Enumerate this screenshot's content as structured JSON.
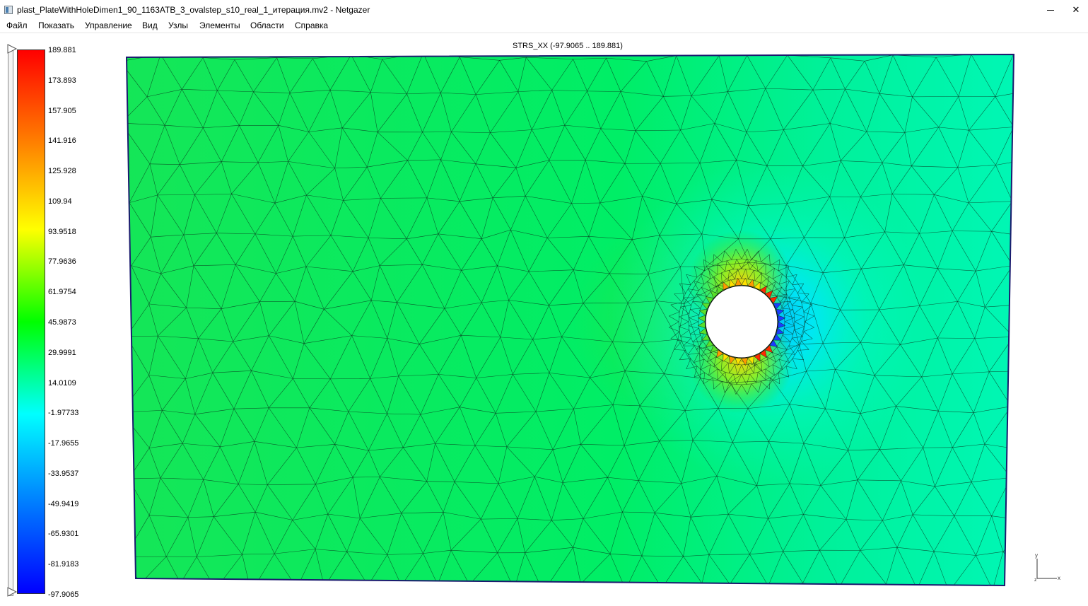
{
  "window": {
    "title": "plast_PlateWithHoleDimen1_90_1163ATB_3_ovalstep_s10_real_1_итерация.mv2 - Netgazer",
    "minimize_icon": "minimize-icon",
    "close_glyph": "✕"
  },
  "menu": {
    "items": [
      "Файл",
      "Показать",
      "Управление",
      "Вид",
      "Узлы",
      "Элементы",
      "Области",
      "Справка"
    ]
  },
  "plot": {
    "title": "STRS_XX (-97.9065 .. 189.881)",
    "field": "STRS_XX",
    "min": -97.9065,
    "max": 189.881
  },
  "color_scale": {
    "labels": [
      "189.881",
      "173.893",
      "157.905",
      "141.916",
      "125.928",
      "109.94",
      "93.9518",
      "77.9636",
      "61.9754",
      "45.9873",
      "29.9991",
      "14.0109",
      "-1.97733",
      "-17.9655",
      "-33.9537",
      "-49.9419",
      "-65.9301",
      "-81.9183",
      "-97.9065"
    ],
    "colors": [
      "#ff0000",
      "#ff8000",
      "#ffff00",
      "#00ff00",
      "#00ffff",
      "#0080ff",
      "#0000ff"
    ]
  },
  "axes_triad": {
    "y_label": "y",
    "x_label": "x",
    "z_label": "z"
  }
}
